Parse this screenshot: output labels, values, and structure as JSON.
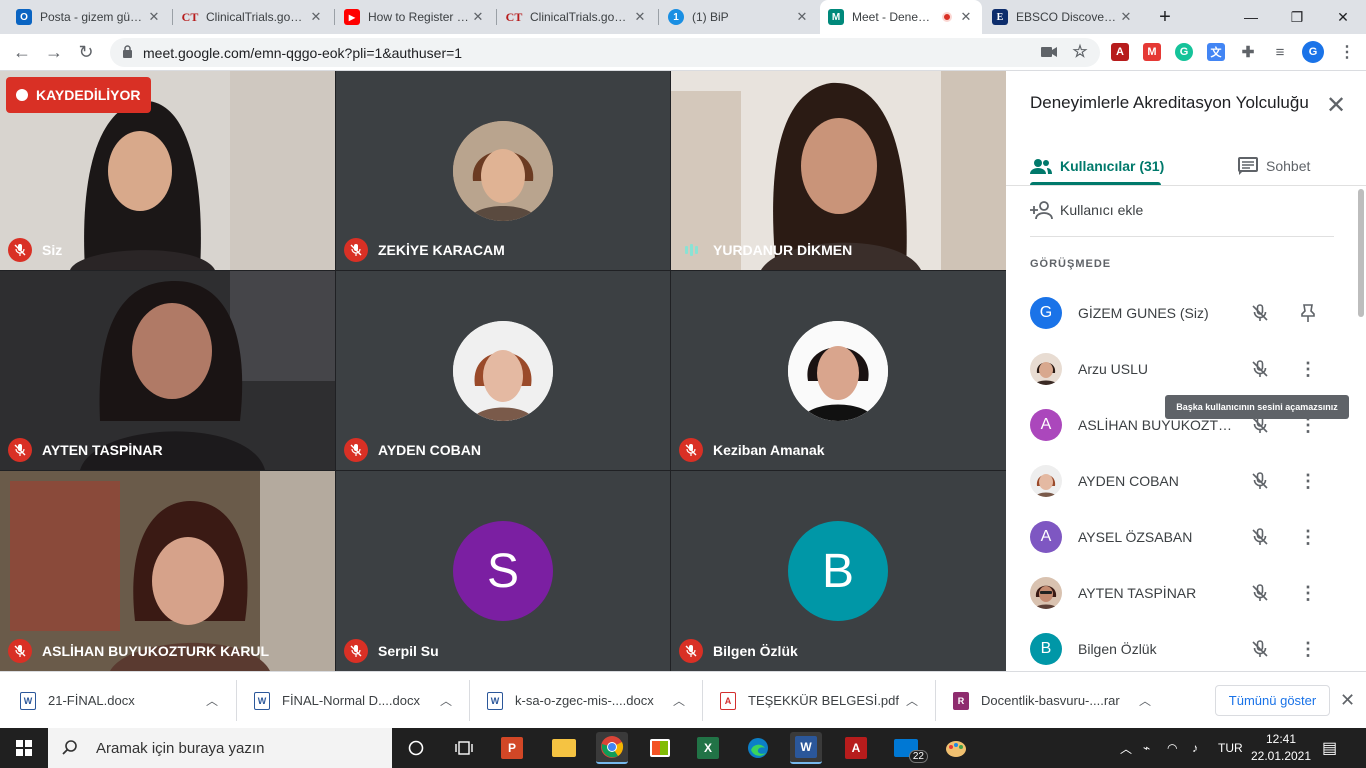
{
  "tabs": [
    {
      "title": "Posta - gizem güneş",
      "favicon": "outlook-icon",
      "color": "#0a64c2",
      "glyph": "O"
    },
    {
      "title": "ClinicalTrials.gov P...",
      "favicon": "ct-icon",
      "color": "#b71c1c",
      "glyph": "CT"
    },
    {
      "title": "How to Register or...",
      "favicon": "youtube-icon",
      "color": "#ff0000",
      "glyph": "▶"
    },
    {
      "title": "ClinicalTrials.gov P...",
      "favicon": "ct-icon",
      "color": "#b71c1c",
      "glyph": "CT"
    },
    {
      "title": "(1) BiP",
      "favicon": "bip-icon",
      "color": "#1a8fe3",
      "glyph": "1"
    },
    {
      "title": "Meet - Deneyimler...",
      "favicon": "meet-icon",
      "color": "#00897b",
      "glyph": "M",
      "active": true
    },
    {
      "title": "EBSCO Discovery S...",
      "favicon": "ebsco-icon",
      "color": "#0d2d6c",
      "glyph": "E"
    }
  ],
  "window_controls": {
    "minimize": "—",
    "restore": "❐",
    "close": "✕"
  },
  "new_tab": "+",
  "url": "meet.google.com/emn-qggo-eok?pli=1&authuser=1",
  "profile_initial": "G",
  "meet": {
    "recording_label": "KAYDEDİLİYOR",
    "tiles": [
      {
        "name": "Siz",
        "type": "video",
        "mic": "muted"
      },
      {
        "name": "ZEKİYE KARACAM",
        "type": "photo",
        "mic": "muted"
      },
      {
        "name": "YURDANUR DİKMEN",
        "type": "video",
        "mic": "speaking"
      },
      {
        "name": "AYTEN TASPİNAR",
        "type": "video",
        "mic": "muted"
      },
      {
        "name": "AYDEN COBAN",
        "type": "photo",
        "mic": "muted"
      },
      {
        "name": "Keziban Amanak",
        "type": "photo",
        "mic": "muted"
      },
      {
        "name": "ASLİHAN BUYUKOZTURK KARUL",
        "type": "video",
        "mic": "muted"
      },
      {
        "name": "Serpil Su",
        "type": "letter",
        "letter": "S",
        "color": "#7b1fa2",
        "mic": "muted"
      },
      {
        "name": "Bilgen Özlük",
        "type": "letter",
        "letter": "B",
        "color": "#0097a7",
        "mic": "muted"
      }
    ]
  },
  "panel": {
    "title": "Deneyimlerle Akreditasyon Yolculuğu",
    "tab_people": "Kullanıcılar (31)",
    "tab_chat": "Sohbet",
    "add_user": "Kullanıcı ekle",
    "section": "GÖRÜŞMEDE",
    "tooltip": "Başka kullanıcının sesini açamazsınız",
    "participants": [
      {
        "name": "GİZEM GUNES (Siz)",
        "avatar": "letter",
        "letter": "G",
        "color": "#1a73e8",
        "action": "pin-icon"
      },
      {
        "name": "Arzu USLU",
        "avatar": "photo",
        "color": "#6d4c41",
        "action": "more-icon"
      },
      {
        "name": "ASLİHAN BUYUKOZTURK KARUL",
        "avatar": "letter",
        "letter": "A",
        "color": "#ab47bc",
        "action": "more-icon"
      },
      {
        "name": "AYDEN COBAN",
        "avatar": "photo",
        "color": "#c49a86",
        "action": "more-icon"
      },
      {
        "name": "AYSEL ÖZSABAN",
        "avatar": "letter",
        "letter": "A",
        "color": "#7e57c2",
        "action": "more-icon"
      },
      {
        "name": "AYTEN TASPİNAR",
        "avatar": "photo",
        "color": "#5d4037",
        "action": "more-icon"
      },
      {
        "name": "Bilgen Özlük",
        "avatar": "letter",
        "letter": "B",
        "color": "#0097a7",
        "action": "more-icon"
      }
    ]
  },
  "downloads": {
    "items": [
      {
        "name": "21-FİNAL.docx",
        "type": "word"
      },
      {
        "name": "FİNAL-Normal D....docx",
        "type": "word"
      },
      {
        "name": "k-sa-o-zgec-mis-....docx",
        "type": "word"
      },
      {
        "name": "TEŞEKKÜR BELGESİ.pdf",
        "type": "pdf"
      },
      {
        "name": "Docentlik-basvuru-....rar",
        "type": "rar"
      }
    ],
    "show_all": "Tümünü göster",
    "close": "✕"
  },
  "taskbar": {
    "search_placeholder": "Aramak için buraya yazın",
    "mail_badge": "22",
    "language": "TUR",
    "time": "12:41",
    "date": "22.01.2021"
  }
}
